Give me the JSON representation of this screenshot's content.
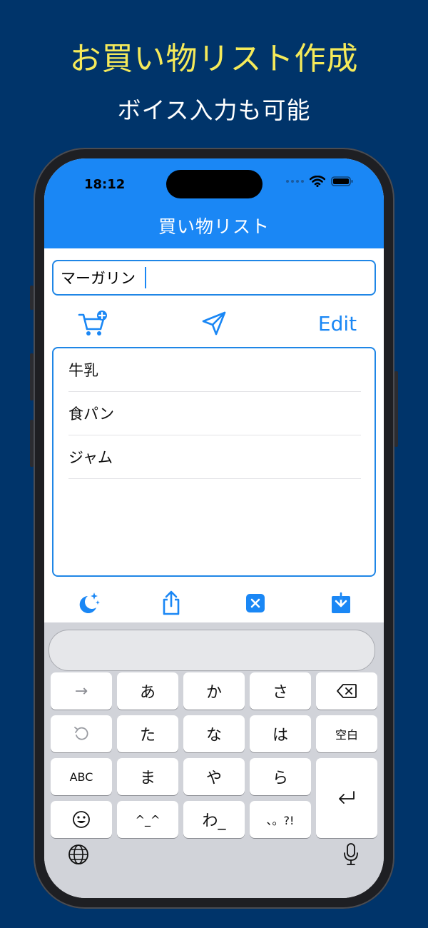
{
  "promo": {
    "headline": "お買い物リスト作成",
    "subline": "ボイス入力も可能"
  },
  "status_bar": {
    "time": "18:12"
  },
  "nav": {
    "title": "買い物リスト"
  },
  "input": {
    "value": "マーガリン",
    "placeholder": ""
  },
  "toolbar": {
    "edit_label": "Edit"
  },
  "list": {
    "items": [
      "牛乳",
      "食パン",
      "ジャム"
    ]
  },
  "keyboard": {
    "rows": [
      [
        "→",
        "あ",
        "か",
        "さ",
        "⌫"
      ],
      [
        "↺",
        "た",
        "な",
        "は",
        "空白"
      ],
      [
        "ABC",
        "ま",
        "や",
        "ら",
        "⏎"
      ],
      [
        "☺",
        "^_^",
        "わ_",
        "、。?!"
      ]
    ]
  },
  "colors": {
    "background": "#00346a",
    "accent": "#1a87f5",
    "headline": "#f5ea5a"
  },
  "icons": {
    "add_to_cart": "cart-plus-icon",
    "send": "paper-plane-icon",
    "dark_mode": "moon-stars-icon",
    "share": "share-icon",
    "clear": "x-square-icon",
    "download": "download-icon",
    "globe": "globe-icon",
    "mic": "microphone-icon"
  }
}
